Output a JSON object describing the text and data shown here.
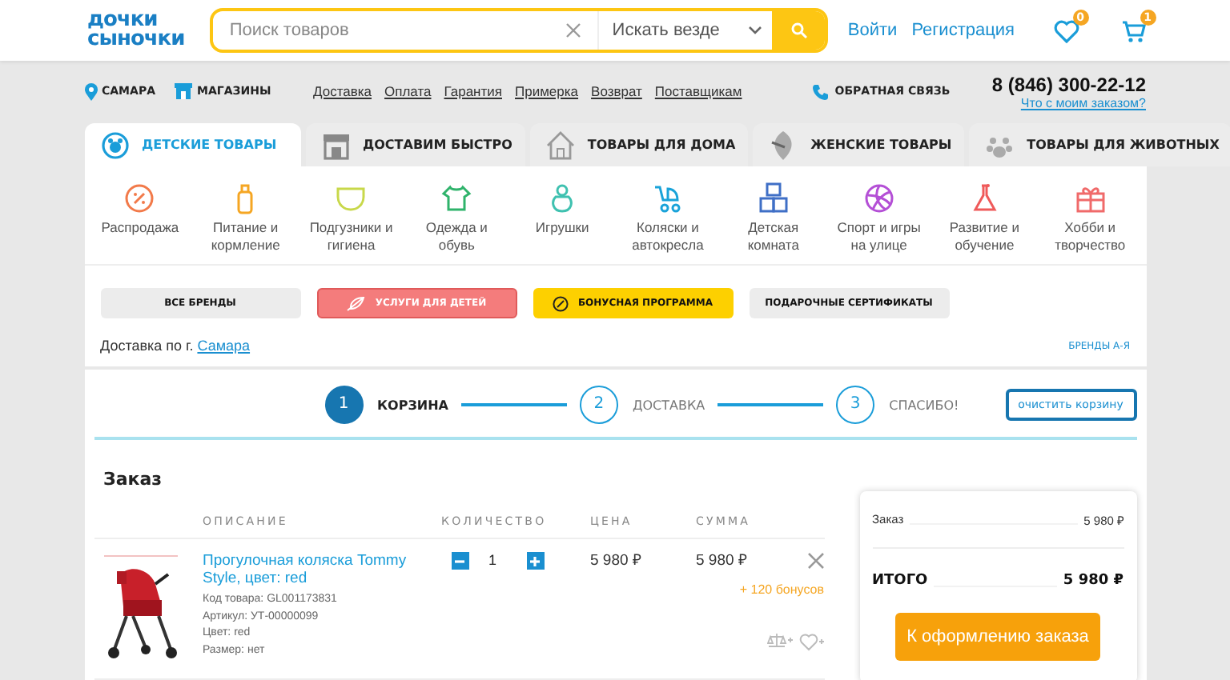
{
  "header": {
    "logo": "дочки сыночки",
    "search": {
      "placeholder": "Поиск товаров",
      "scope": "Искать везде"
    },
    "login": "Войти",
    "register": "Регистрация",
    "favorites_badge": "0",
    "cart_badge": "1"
  },
  "subheader": {
    "city": "САМАРА",
    "stores": "МАГАЗИНЫ",
    "links": [
      "Доставка",
      "Оплата",
      "Гарантия",
      "Примерка",
      "Возврат",
      "Поставщикам"
    ],
    "feedback": "ОБРАТНАЯ СВЯЗЬ",
    "phone": "8 (846) 300-22-12",
    "order_status": "Что с моим заказом?"
  },
  "tabs": [
    {
      "label": "ДЕТСКИЕ ТОВАРЫ",
      "selected": true
    },
    {
      "label": "ДОСТАВИМ БЫСТРО",
      "selected": false
    },
    {
      "label": "ТОВАРЫ ДЛЯ ДОМА",
      "selected": false
    },
    {
      "label": "ЖЕНСКИЕ ТОВАРЫ",
      "selected": false
    },
    {
      "label": "ТОВАРЫ ДЛЯ ЖИВОТНЫХ",
      "selected": false
    }
  ],
  "categories": [
    {
      "label": "Распродажа",
      "color": "#f27a4a"
    },
    {
      "label": "Питание и кормление",
      "color": "#f5a623"
    },
    {
      "label": "Подгузники и гигиена",
      "color": "#c8d84a"
    },
    {
      "label": "Одежда и обувь",
      "color": "#2fb36b"
    },
    {
      "label": "Игрушки",
      "color": "#3fc1b0"
    },
    {
      "label": "Коляски и автокресла",
      "color": "#1aa3d9"
    },
    {
      "label": "Детская комната",
      "color": "#3f6fc6"
    },
    {
      "label": "Спорт и игры на улице",
      "color": "#b44fd6"
    },
    {
      "label": "Развитие и обучение",
      "color": "#ef5a5a"
    },
    {
      "label": "Хобби и творчество",
      "color": "#f06a6a"
    }
  ],
  "promos": [
    {
      "label": "ВСЕ БРЕНДЫ",
      "kind": "plain"
    },
    {
      "label": "УСЛУГИ ДЛЯ ДЕТЕЙ",
      "kind": "red"
    },
    {
      "label": "БОНУСНАЯ ПРОГРАММА",
      "kind": "yellow"
    },
    {
      "label": "ПОДАРОЧНЫЕ СЕРТИФИКАТЫ",
      "kind": "plain"
    }
  ],
  "delivery": {
    "text": "Доставка по г.",
    "city": "Самара"
  },
  "brands_link": "БРЕНДЫ А-Я",
  "steps": [
    {
      "number": "1",
      "label": "КОРЗИНА",
      "selected": true
    },
    {
      "number": "2",
      "label": "ДОСТАВКА",
      "selected": false
    },
    {
      "number": "3",
      "label": "СПАСИБО!",
      "selected": false
    }
  ],
  "clear_cart": "очистить корзину",
  "order": {
    "title": "Заказ",
    "columns": [
      "ОПИСАНИЕ",
      "КОЛИЧЕСТВО",
      "ЦЕНА",
      "СУММА"
    ],
    "items": [
      {
        "image": {
          "kind": "picture"
        },
        "name": "Прогулочная коляска Tommy Style, цвет: red",
        "details": [
          "Код товара: GL001173831",
          "Артикул: УТ-00000099",
          "Цвет: red",
          "Размер: нет"
        ],
        "quantity": "1",
        "price": "5 980 ₽",
        "sum": "5 980 ₽",
        "bonus": "+ 120 бонусов"
      }
    ]
  },
  "summary": {
    "order_label": "Заказ",
    "order_value": "5 980 ₽",
    "total_label": "ИТОГО",
    "total_value": "5 980 ₽",
    "checkout": "К оформлению заказа"
  }
}
